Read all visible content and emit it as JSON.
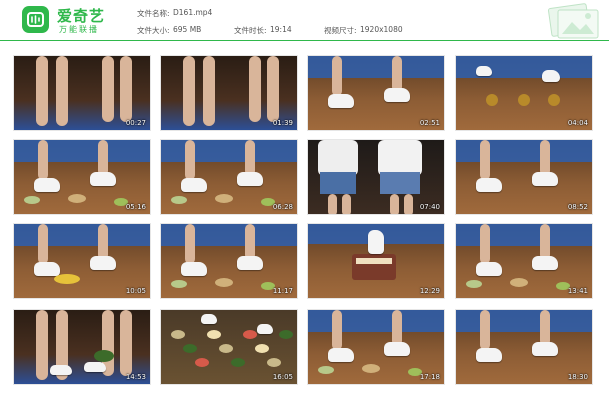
{
  "header": {
    "brand_name": "爱奇艺",
    "brand_sub": "万能联播",
    "file_name_label": "文件名称:",
    "file_name": "D161.mp4",
    "file_size_label": "文件大小:",
    "file_size": "695 MB",
    "duration_label": "文件时长:",
    "duration": "19:14",
    "resolution_label": "视频尺寸:",
    "resolution": "1920x1080",
    "brand_color": "#2fb84b"
  },
  "thumbnails": [
    {
      "timestamp": "00:27"
    },
    {
      "timestamp": "01:39"
    },
    {
      "timestamp": "02:51"
    },
    {
      "timestamp": "04:04"
    },
    {
      "timestamp": "05:16"
    },
    {
      "timestamp": "06:28"
    },
    {
      "timestamp": "07:40"
    },
    {
      "timestamp": "08:52"
    },
    {
      "timestamp": "10:05"
    },
    {
      "timestamp": "11:17"
    },
    {
      "timestamp": "12:29"
    },
    {
      "timestamp": "13:41"
    },
    {
      "timestamp": "14:53"
    },
    {
      "timestamp": "16:05"
    },
    {
      "timestamp": "17:18"
    },
    {
      "timestamp": "18:30"
    }
  ]
}
